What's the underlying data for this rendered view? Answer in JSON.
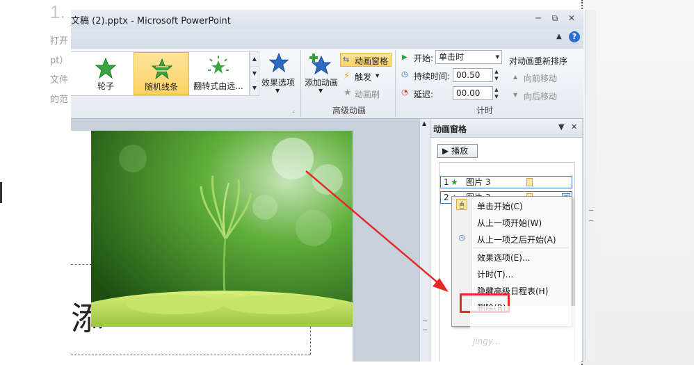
{
  "window": {
    "title": "文稿 (2).pptx - Microsoft PowerPoint",
    "controls": [
      "─",
      "⧉",
      "✕"
    ],
    "help": "?"
  },
  "background": {
    "heading": "1.",
    "text_lines": [
      "打开",
      "pt）",
      "文件",
      "的范"
    ]
  },
  "ribbon": {
    "effects": [
      {
        "label": "轮子",
        "icon": "green-star-icon"
      },
      {
        "label": "随机线条",
        "icon": "green-star-icon",
        "selected": true
      },
      {
        "label": "翻转式由远...",
        "icon": "green-star-burst-icon"
      }
    ],
    "effect_options": "效果选项",
    "add_animation": "添加动画",
    "animation_pane": "动画窗格",
    "trigger": "触发",
    "animation_painter": "动画刷",
    "advanced_group": "高级动画",
    "start_label": "开始:",
    "start_value": "单击时",
    "duration_label": "持续时间:",
    "duration_value": "00.50",
    "delay_label": "延迟:",
    "delay_value": "00.00",
    "timing_group": "计时",
    "reorder_title": "对动画重新排序",
    "move_earlier": "向前移动",
    "move_later": "向后移动"
  },
  "slide": {
    "partial_char": "添"
  },
  "animation_pane": {
    "title": "动画窗格",
    "play": "播放",
    "items": [
      {
        "num": "1",
        "name": "图片 3"
      },
      {
        "num": "2",
        "name": "图片 3"
      }
    ]
  },
  "context_menu": {
    "items": [
      {
        "label": "单击开始(C)",
        "icon": "mouse-click-icon"
      },
      {
        "label": "从上一项开始(W)",
        "icon": ""
      },
      {
        "label": "从上一项之后开始(A)",
        "icon": "clock-icon"
      },
      {
        "label": "效果选项(E)...",
        "icon": ""
      },
      {
        "label": "计时(T)...",
        "icon": ""
      },
      {
        "label": "隐藏高级日程表(H)",
        "icon": ""
      },
      {
        "label": "删除(R)",
        "icon": ""
      }
    ]
  },
  "watermark": "jingy..."
}
